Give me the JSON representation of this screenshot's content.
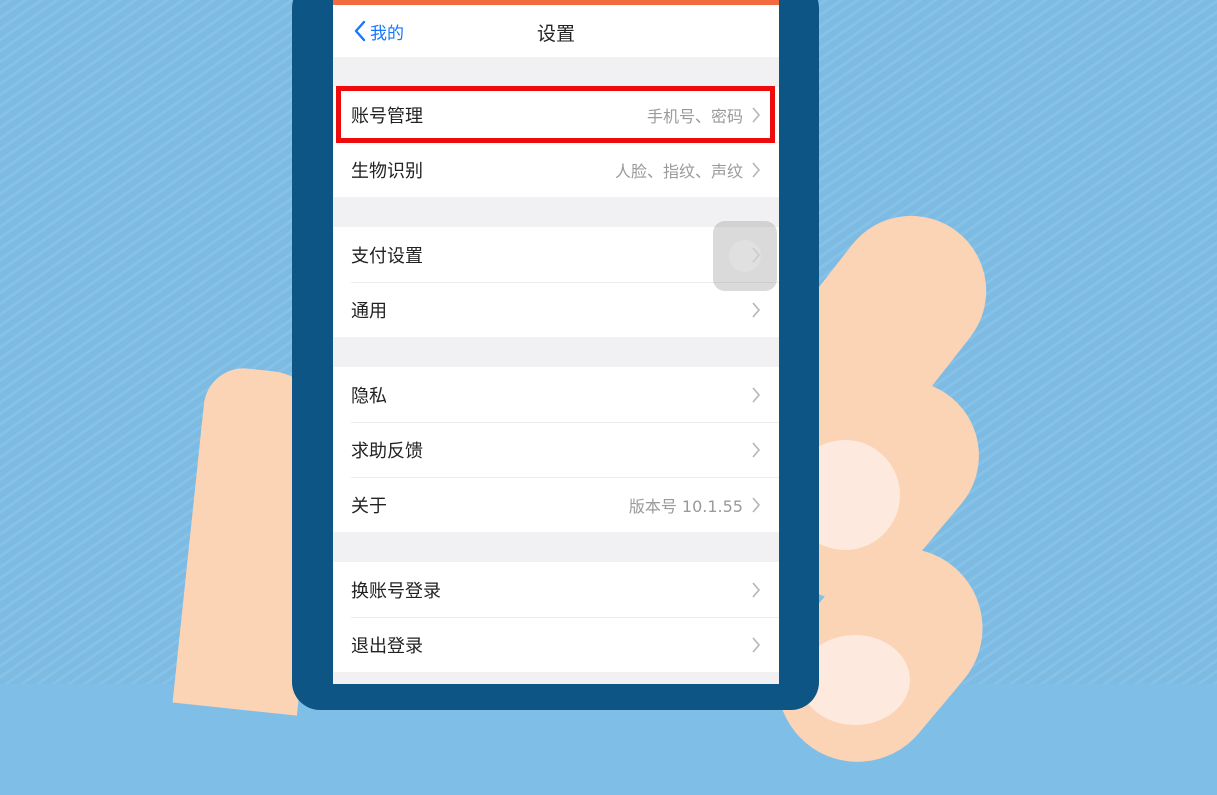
{
  "nav": {
    "back_label": "我的",
    "title": "设置"
  },
  "groups": [
    {
      "rows": [
        {
          "label": "账号管理",
          "detail": "手机号、密码"
        },
        {
          "label": "生物识别",
          "detail": "人脸、指纹、声纹"
        }
      ]
    },
    {
      "rows": [
        {
          "label": "支付设置",
          "detail": ""
        },
        {
          "label": "通用",
          "detail": ""
        }
      ]
    },
    {
      "rows": [
        {
          "label": "隐私",
          "detail": ""
        },
        {
          "label": "求助反馈",
          "detail": ""
        },
        {
          "label": "关于",
          "detail": "版本号 10.1.55"
        }
      ]
    },
    {
      "rows": [
        {
          "label": "换账号登录",
          "detail": ""
        },
        {
          "label": "退出登录",
          "detail": ""
        }
      ]
    }
  ],
  "colors": {
    "accent": "#1677ff",
    "highlight": "#ee0b0b",
    "status_bar": "#f26a3e",
    "phone_body": "#0c5585"
  },
  "icons": {
    "back": "chevron-left-icon",
    "row_arrow": "chevron-right-icon"
  }
}
